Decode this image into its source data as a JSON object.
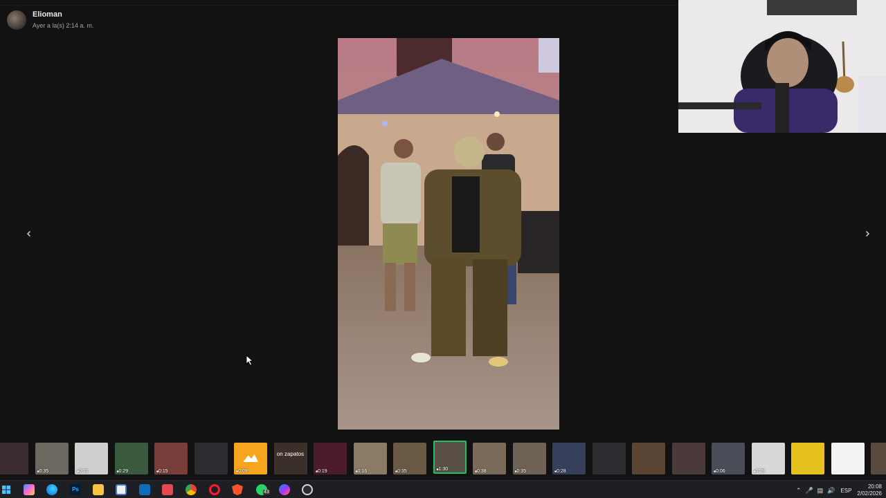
{
  "viewer": {
    "sender_name": "Elioman",
    "timestamp": "Ayer a la(s) 2:14 a. m.",
    "prev_icon": "chevron-left-icon",
    "next_icon": "chevron-right-icon"
  },
  "thumbnails": [
    {
      "duration": "",
      "color": "#3c2e30"
    },
    {
      "duration": "0:35",
      "color": "#6b6860"
    },
    {
      "duration": "0:12",
      "color": "#cfcfcd"
    },
    {
      "duration": "0:29",
      "color": "#3a5a3e"
    },
    {
      "duration": "0:15",
      "color": "#7a3e3a"
    },
    {
      "duration": "",
      "color": "#2b2d30"
    },
    {
      "duration": "0:09",
      "color": "#f5a51e",
      "icon": "image-icon"
    },
    {
      "duration": "",
      "color": "#3b2f2a",
      "overlay": "on zapatos"
    },
    {
      "duration": "0:19",
      "color": "#4a1c2e"
    },
    {
      "duration": "0:16",
      "color": "#8a7a66"
    },
    {
      "duration": "0:35",
      "color": "#6a5a44"
    },
    {
      "duration": "1:30",
      "color": "#5a5048",
      "selected": true
    },
    {
      "duration": "0:38",
      "color": "#7a6a5a"
    },
    {
      "duration": "0:35",
      "color": "#6e6256"
    },
    {
      "duration": "0:28",
      "color": "#36405a"
    },
    {
      "duration": "",
      "color": "#2c2d30"
    },
    {
      "duration": "",
      "color": "#5a4434"
    },
    {
      "duration": "",
      "color": "#4a3a3a"
    },
    {
      "duration": "0:06",
      "color": "#4a4e58"
    },
    {
      "duration": "0:28",
      "color": "#d8d8d8"
    },
    {
      "duration": "",
      "color": "#e6c21e"
    },
    {
      "duration": "",
      "color": "#f2f2f2"
    },
    {
      "duration": "",
      "color": "#5a4a40"
    }
  ],
  "taskbar": {
    "whatsapp_badge": "43",
    "language": "ESP",
    "time": "20:08",
    "date": "2/02/2026",
    "icons": [
      "windows-start-icon",
      "copilot-icon",
      "edge-icon",
      "photoshop-icon",
      "file-explorer-icon",
      "store-icon",
      "outlook-icon",
      "calendar-icon",
      "chrome-icon",
      "opera-icon",
      "brave-icon",
      "whatsapp-icon",
      "messenger-icon",
      "media-player-icon"
    ]
  },
  "colors": {
    "background": "#111211",
    "selected_border": "#21c063",
    "taskbar": "#1e1f22"
  }
}
